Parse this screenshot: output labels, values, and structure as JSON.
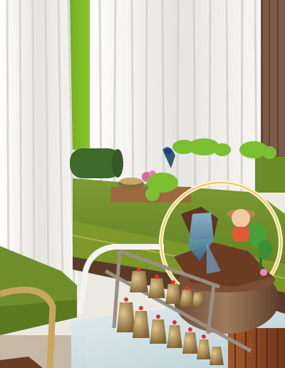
{
  "scene": {
    "alt": "",
    "palette": {
      "curtain": "#f2f1ee",
      "curtain_shadow": "#d9d7d2",
      "green_wall": "#79b625",
      "bed_green": "#6e8f2a",
      "bed_green_dark": "#4f6d16",
      "bolster": "#3f6a2c",
      "brown_curtain": "#7a5a48",
      "glass_table": "#cfe0e3",
      "wood": "#8a4a26",
      "brass": "#c9a560",
      "bronze_bell": "#9c7f4e",
      "ceramic": "#8a5a3a",
      "moss": "#7cbf32",
      "ring_glow": "#fff4c8"
    }
  }
}
